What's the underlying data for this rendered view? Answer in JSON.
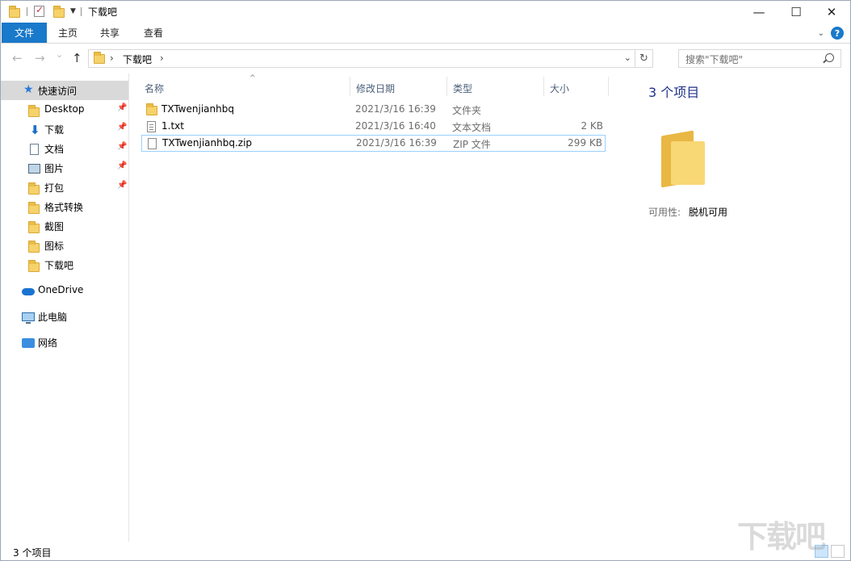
{
  "window": {
    "title": "下载吧",
    "minimize": "—",
    "maximize": "☐",
    "close": "✕"
  },
  "ribbon": {
    "tabs": [
      "文件",
      "主页",
      "共享",
      "查看"
    ],
    "help": "?",
    "expand": "⌄"
  },
  "nav_buttons": {
    "back": "←",
    "forward": "→",
    "recent": "⌄",
    "up": "↑"
  },
  "address": {
    "sep1": "›",
    "path": "下载吧",
    "sep2": "›",
    "dropdown": "⌄",
    "refresh": "↻"
  },
  "search": {
    "placeholder": "搜索\"下载吧\""
  },
  "nav_pane": {
    "quick_access": "快速访问",
    "items": [
      {
        "label": "Desktop",
        "pinned": true,
        "icon": "folder-icon"
      },
      {
        "label": "下载",
        "pinned": true,
        "icon": "download-icon"
      },
      {
        "label": "文档",
        "pinned": true,
        "icon": "document-icon"
      },
      {
        "label": "图片",
        "pinned": true,
        "icon": "pictures-icon"
      },
      {
        "label": "打包",
        "pinned": true,
        "icon": "folder-icon"
      },
      {
        "label": "格式转换",
        "pinned": false,
        "icon": "folder-icon"
      },
      {
        "label": "截图",
        "pinned": false,
        "icon": "folder-icon"
      },
      {
        "label": "图标",
        "pinned": false,
        "icon": "folder-icon"
      },
      {
        "label": "下载吧",
        "pinned": false,
        "icon": "folder-icon"
      }
    ],
    "onedrive": "OneDrive",
    "this_pc": "此电脑",
    "network": "网络",
    "pin_glyph": "📌"
  },
  "columns": {
    "name": "名称",
    "date": "修改日期",
    "type": "类型",
    "size": "大小",
    "sort_indicator": "^"
  },
  "files": [
    {
      "name": "TXTwenjianhbq",
      "date": "2021/3/16 16:39",
      "type": "文件夹",
      "size": "",
      "icon": "folder-icon"
    },
    {
      "name": "1.txt",
      "date": "2021/3/16 16:40",
      "type": "文本文档",
      "size": "2 KB",
      "icon": "text-file-icon"
    },
    {
      "name": "TXTwenjianhbq.zip",
      "date": "2021/3/16 16:39",
      "type": "ZIP 文件",
      "size": "299 KB",
      "icon": "zip-file-icon"
    }
  ],
  "details": {
    "title": "3 个项目",
    "availability_label": "可用性:",
    "availability_value": "脱机可用"
  },
  "status": {
    "text": "3 个项目"
  },
  "watermark": "下载吧",
  "colors": {
    "accent": "#1979ca",
    "selected": "#d9d9d9",
    "focus": "#99d1ff"
  }
}
